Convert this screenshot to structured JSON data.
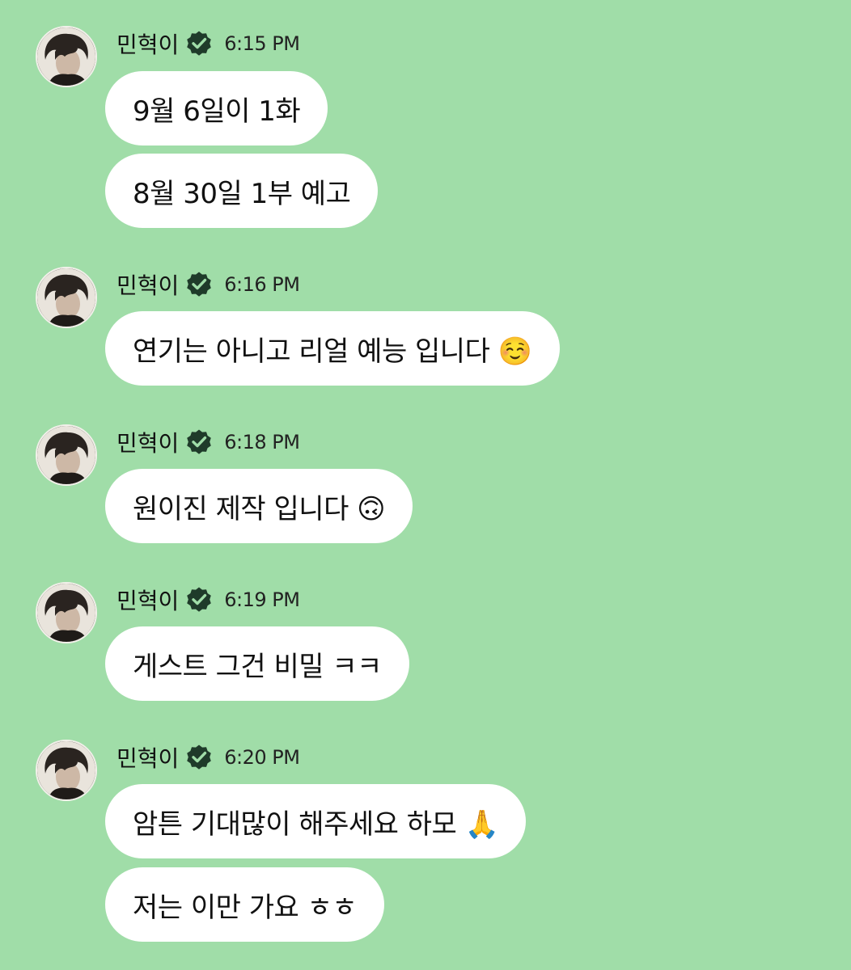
{
  "chat": {
    "groups": [
      {
        "sender": "민혁이",
        "time": "6:15 PM",
        "messages": [
          "9월 6일이 1화",
          "8월 30일 1부 예고"
        ]
      },
      {
        "sender": "민혁이",
        "time": "6:16 PM",
        "messages": [
          "연기는 아니고 리얼 예능 입니다 ☺️"
        ]
      },
      {
        "sender": "민혁이",
        "time": "6:18 PM",
        "messages": [
          "원이진 제작 입니다 🙃"
        ]
      },
      {
        "sender": "민혁이",
        "time": "6:19 PM",
        "messages": [
          "게스트 그건 비밀 ㅋㅋ"
        ]
      },
      {
        "sender": "민혁이",
        "time": "6:20 PM",
        "messages": [
          "암튼 기대많이 해주세요 하모 🙏",
          "저는 이만 가요 ㅎㅎ"
        ]
      }
    ],
    "colors": {
      "background": "#a0dda8",
      "bubble": "#ffffff",
      "badge": "#1f3b2a"
    },
    "icons": {
      "verified": "verified-badge-icon",
      "avatar": "profile-avatar"
    }
  }
}
